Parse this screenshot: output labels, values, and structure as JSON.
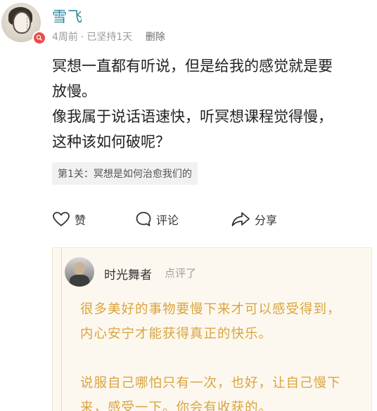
{
  "post": {
    "author": "雪飞",
    "time": "4周前",
    "streak": "已坚持1天",
    "delete_label": "删除",
    "body_lines": [
      "冥想一直都有听说，但是给我的感觉就是要",
      "放慢。",
      "像我属于说话语速快，听冥想课程觉得慢，",
      "这种该如何破呢？"
    ],
    "tag": "第1关：冥想是如何治愈我们的"
  },
  "actions": {
    "like_label": "赞",
    "comment_label": "评论",
    "share_label": "分享"
  },
  "comment": {
    "author": "时光舞者",
    "action": "点评了",
    "paragraphs": [
      [
        "很多美好的事物要慢下来才可以感受得到，",
        "内心安宁才能获得真正的快乐。"
      ],
      [
        "说服自己哪怕只有一次，也好，让自己慢下",
        "来，感受一下。你会有收获的。"
      ]
    ]
  },
  "colors": {
    "username": "#2c8a9e",
    "comment_text": "#d9a440",
    "card_bg": "#fdf8ef"
  }
}
